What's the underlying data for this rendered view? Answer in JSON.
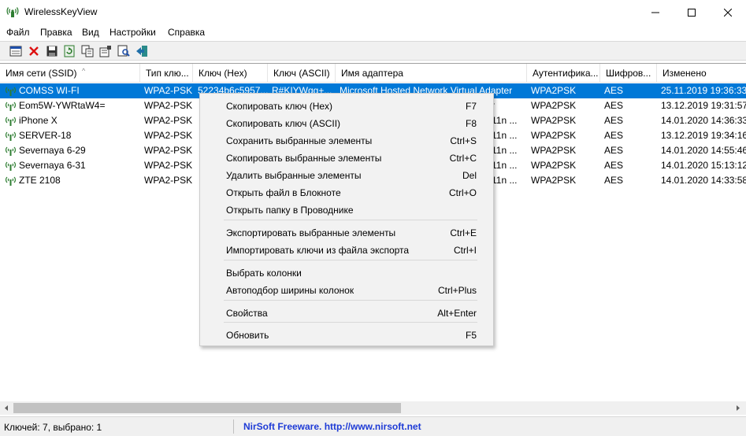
{
  "window": {
    "title": "WirelessKeyView"
  },
  "menu": [
    "Файл",
    "Правка",
    "Вид",
    "Настройки",
    "Справка"
  ],
  "toolbar": [
    "options-icon",
    "delete-icon",
    "save-icon",
    "refresh-icon",
    "copy-icon",
    "properties-icon",
    "find-icon",
    "exit-icon"
  ],
  "table": {
    "columns": [
      "Имя сети (SSID)",
      "Тип клю...",
      "Ключ (Hex)",
      "Ключ (ASCII)",
      "Имя адаптера",
      "Аутентифика...",
      "Шифров...",
      "Изменено"
    ],
    "sort_indicator": "^",
    "rows": [
      [
        "COMSS WI-FI",
        "WPA2-PSK",
        "52234b6c5957...",
        "R#KIYWqg+...",
        "Microsoft Hosted Network Virtual Adapter",
        "WPA2PSK",
        "AES",
        "25.11.2019 19:36:33"
      ],
      [
        "Eom5W-YWRtaW4=",
        "WPA2-PSK",
        "",
        "",
        "r",
        "WPA2PSK",
        "AES",
        "13.12.2019 19:31:57"
      ],
      [
        "iPhone X",
        "WPA2-PSK",
        "",
        "",
        "11n ...",
        "WPA2PSK",
        "AES",
        "14.01.2020 14:36:33"
      ],
      [
        "SERVER-18",
        "WPA2-PSK",
        "",
        "",
        "11n ...",
        "WPA2PSK",
        "AES",
        "13.12.2019 19:34:16"
      ],
      [
        "Severnaya 6-29",
        "WPA2-PSK",
        "",
        "",
        "11n ...",
        "WPA2PSK",
        "AES",
        "14.01.2020 14:55:46"
      ],
      [
        "Severnaya 6-31",
        "WPA2-PSK",
        "",
        "",
        "11n ...",
        "WPA2PSK",
        "AES",
        "14.01.2020 15:13:12"
      ],
      [
        "ZTE 2108",
        "WPA2-PSK",
        "",
        "",
        "11n ...",
        "WPA2PSK",
        "AES",
        "14.01.2020 14:33:58"
      ]
    ]
  },
  "context_menu": [
    {
      "label": "Скопировать ключ (Hex)",
      "shortcut": "F7"
    },
    {
      "label": "Скопировать ключ (ASCII)",
      "shortcut": "F8"
    },
    {
      "label": "Сохранить выбранные элементы",
      "shortcut": "Ctrl+S"
    },
    {
      "label": "Скопировать выбранные элементы",
      "shortcut": "Ctrl+C"
    },
    {
      "label": "Удалить выбранные элементы",
      "shortcut": "Del"
    },
    {
      "label": "Открыть файл в Блокноте",
      "shortcut": "Ctrl+O"
    },
    {
      "label": "Открыть папку в Проводнике",
      "shortcut": ""
    },
    {
      "label": "Экспортировать выбранные элементы",
      "shortcut": "Ctrl+E"
    },
    {
      "label": "Импортировать ключи из файла экспорта",
      "shortcut": "Ctrl+I"
    },
    {
      "label": "Выбрать колонки",
      "shortcut": ""
    },
    {
      "label": "Автоподбор ширины колонок",
      "shortcut": "Ctrl+Plus"
    },
    {
      "label": "Свойства",
      "shortcut": "Alt+Enter"
    },
    {
      "label": "Обновить",
      "shortcut": "F5"
    }
  ],
  "status": {
    "count": "Ключей: 7, выбрано: 1",
    "link": "NirSoft Freeware.  http://www.nirsoft.net"
  },
  "colors": {
    "selection": "#0078d7",
    "link": "#1e3bd6"
  }
}
